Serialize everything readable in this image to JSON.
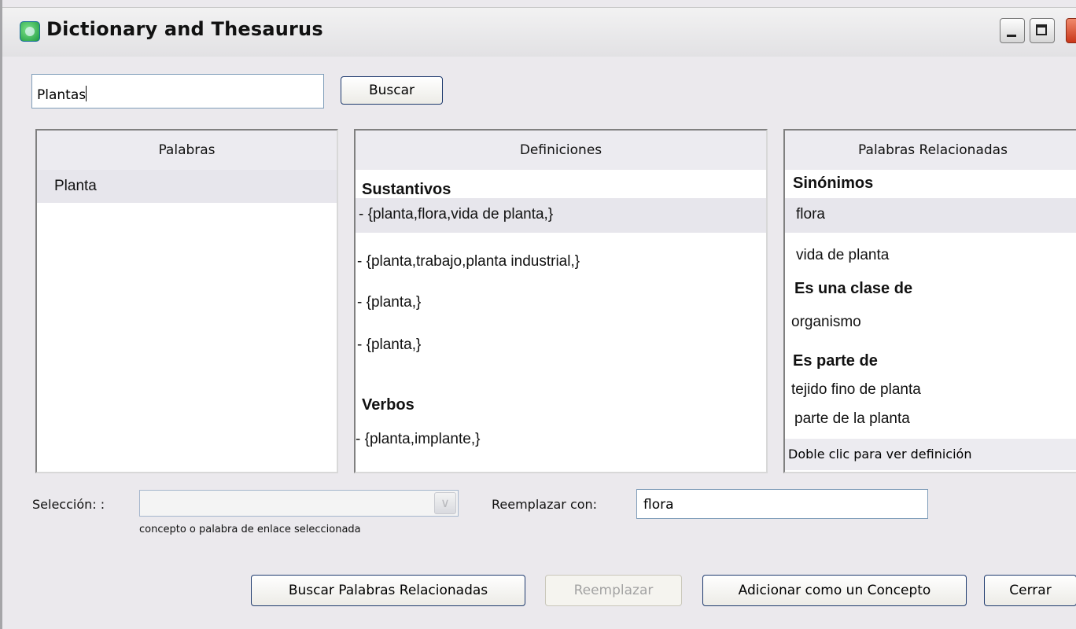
{
  "window": {
    "title": "Dictionary and Thesaurus",
    "controls": [
      "minimize-icon",
      "maximize-icon",
      "close-icon"
    ]
  },
  "search": {
    "value": "Plantas",
    "button_label": "Buscar"
  },
  "palabras": {
    "header": "Palabras",
    "items": [
      "Planta"
    ]
  },
  "definiciones": {
    "header": "Definiciones",
    "sustantivos_heading": "Sustantivos",
    "sustantivos": [
      " - {planta,flora,vida de planta,}",
      "- {planta,trabajo,planta industrial,}",
      "- {planta,}",
      " - {planta,}"
    ],
    "verbos_heading": "Verbos",
    "verbos": [
      "- {planta,implante,}"
    ]
  },
  "relacionadas": {
    "header": "Palabras Relacionadas",
    "sinonimos_heading": "Sinónimos",
    "sinonimos": [
      "flora",
      "vida de planta"
    ],
    "clase_heading": "Es una clase de",
    "clase": [
      "organismo"
    ],
    "parte_heading": "Es parte de",
    "parte": [
      "tejido fino de planta",
      "parte de la planta"
    ],
    "footer": "Doble clic  para ver definición"
  },
  "seleccion": {
    "label": "Selección: :",
    "hint": "concepto o palabra de  enlace seleccionada",
    "value": ""
  },
  "reemplazar": {
    "label": "Reemplazar con:",
    "value": "flora"
  },
  "actions": {
    "buscar_relacionadas": "Buscar Palabras Relacionadas",
    "reemplazar": "Reemplazar",
    "adicionar": "Adicionar como un Concepto",
    "cerrar": "Cerrar"
  }
}
